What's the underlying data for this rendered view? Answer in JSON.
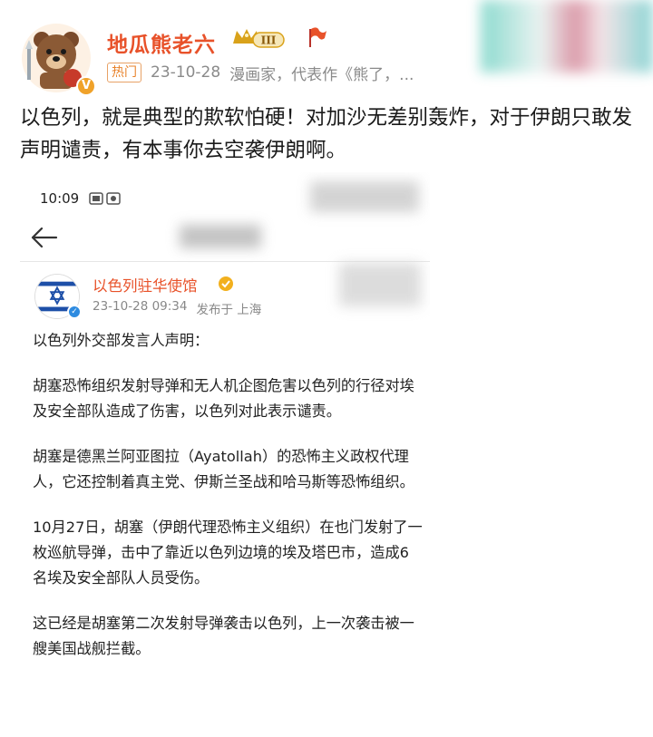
{
  "post": {
    "user_name": "地瓜熊老六",
    "level_badge": "III",
    "hot_tag": "热门",
    "date": "23-10-28",
    "bio": "漫画家，代表作《熊了，...",
    "verified_mark": "V",
    "text": "以色列，就是典型的欺软怕硬！对加沙无差别轰炸，对于伊朗只敢发声明谴责，有本事你去空袭伊朗啊。"
  },
  "screenshot": {
    "time": "10:09",
    "account_name": "以色列驻华使馆",
    "date_time": "23-10-28 09:34",
    "location": "发布于 上海",
    "paragraphs": [
      "以色列外交部发言人声明：",
      "胡塞恐怖组织发射导弹和无人机企图危害以色列的行径对埃及安全部队造成了伤害，以色列对此表示谴责。",
      "胡塞是德黑兰阿亚图拉（Ayatollah）的恐怖主义政权代理人，它还控制着真主党、伊斯兰圣战和哈马斯等恐怖组织。",
      "10月27日，胡塞（伊朗代理恐怖主义组织）在也门发射了一枚巡航导弹，击中了靠近以色列边境的埃及塔巴市，造成6名埃及安全部队人员受伤。",
      "这已经是胡塞第二次发射导弹袭击以色列，上一次袭击被一艘美国战舰拦截。"
    ]
  },
  "colors": {
    "username": "#e8522a",
    "meta_gray": "#8a8a8a",
    "hot_tag": "#e8822a"
  },
  "icons": [
    "bear-avatar-icon",
    "crown-level-icon",
    "flag-icon",
    "back-arrow-icon",
    "israel-flag-avatar-icon",
    "verified-icon"
  ]
}
